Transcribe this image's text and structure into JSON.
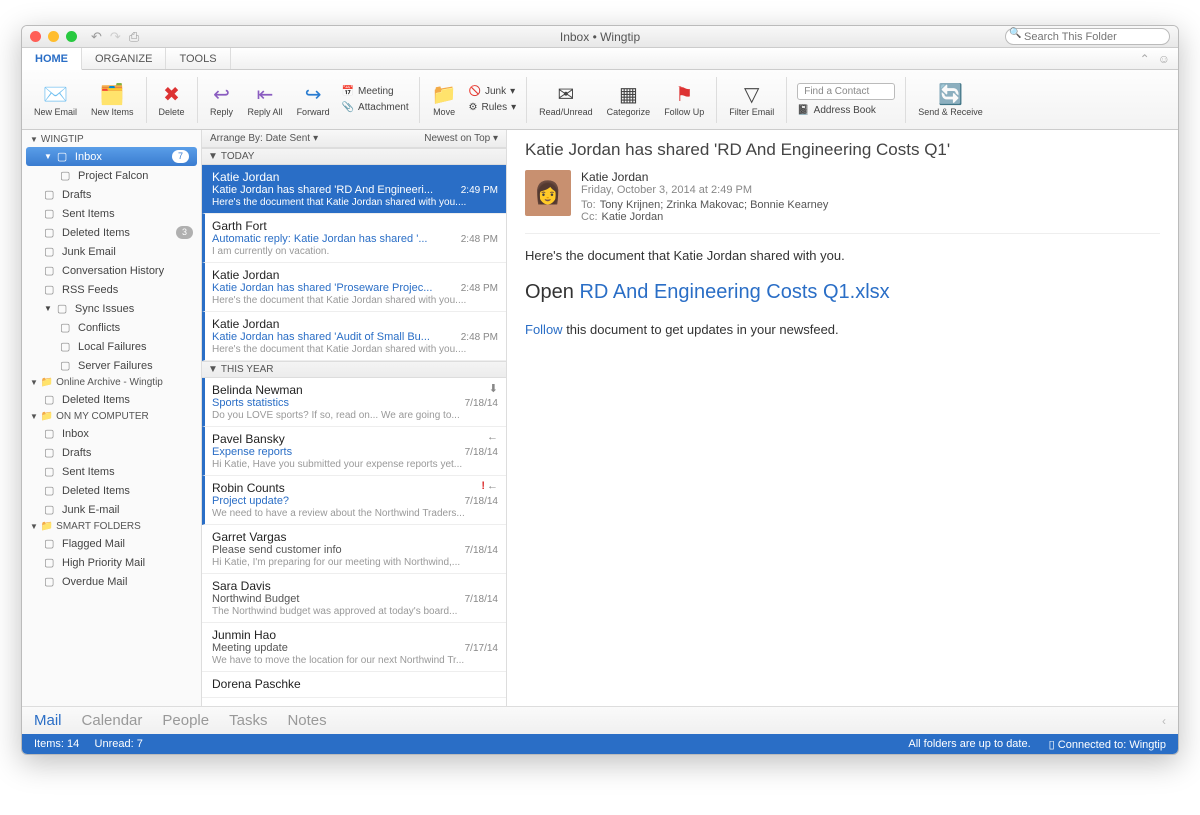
{
  "titlebar": {
    "title": "Inbox • Wingtip",
    "search_placeholder": "Search This Folder"
  },
  "tabs": {
    "home": "HOME",
    "organize": "ORGANIZE",
    "tools": "TOOLS"
  },
  "ribbon": {
    "new_email": "New\nEmail",
    "new_items": "New\nItems",
    "delete": "Delete",
    "reply": "Reply",
    "reply_all": "Reply\nAll",
    "forward": "Forward",
    "meeting": "Meeting",
    "attachment": "Attachment",
    "move": "Move",
    "junk": "Junk",
    "rules": "Rules",
    "read_unread": "Read/Unread",
    "categorize": "Categorize",
    "follow_up": "Follow\nUp",
    "filter_email": "Filter\nEmail",
    "find_contact": "Find a Contact",
    "address_book": "Address Book",
    "send_receive": "Send &\nReceive"
  },
  "sidebar": {
    "accounts": [
      {
        "label": "WINGTIP",
        "items": [
          {
            "label": "Inbox",
            "badge": "7",
            "selected": true
          },
          {
            "label": "Project Falcon",
            "level": 2
          },
          {
            "label": "Drafts"
          },
          {
            "label": "Sent Items"
          },
          {
            "label": "Deleted Items",
            "badge": "3"
          },
          {
            "label": "Junk Email"
          },
          {
            "label": "Conversation History"
          },
          {
            "label": "RSS Feeds"
          },
          {
            "label": "Sync Issues",
            "collapsible": true
          },
          {
            "label": "Conflicts",
            "level": 2
          },
          {
            "label": "Local Failures",
            "level": 2
          },
          {
            "label": "Server Failures",
            "level": 2
          }
        ]
      },
      {
        "label": "Online Archive - Wingtip",
        "items": [
          {
            "label": "Deleted Items"
          }
        ]
      },
      {
        "label": "ON MY COMPUTER",
        "items": [
          {
            "label": "Inbox"
          },
          {
            "label": "Drafts"
          },
          {
            "label": "Sent Items"
          },
          {
            "label": "Deleted Items"
          },
          {
            "label": "Junk E-mail"
          }
        ]
      },
      {
        "label": "SMART FOLDERS",
        "items": [
          {
            "label": "Flagged Mail"
          },
          {
            "label": "High Priority Mail"
          },
          {
            "label": "Overdue Mail"
          }
        ]
      }
    ]
  },
  "arrange": {
    "by": "Arrange By: Date Sent",
    "sort": "Newest on Top"
  },
  "groups": [
    {
      "label": "TODAY",
      "messages": [
        {
          "from": "Katie Jordan",
          "subject": "Katie Jordan has shared 'RD And Engineeri...",
          "time": "2:49 PM",
          "preview": "Here's the document that Katie Jordan shared with you....",
          "unread": true,
          "selected": true
        },
        {
          "from": "Garth Fort",
          "subject": "Automatic reply: Katie Jordan has shared '...",
          "time": "2:48 PM",
          "preview": "I am currently on vacation.",
          "unread": true
        },
        {
          "from": "Katie Jordan",
          "subject": "Katie Jordan has shared 'Proseware Projec...",
          "time": "2:48 PM",
          "preview": "Here's the document that Katie Jordan shared with you....",
          "unread": true
        },
        {
          "from": "Katie Jordan",
          "subject": "Katie Jordan has shared 'Audit of Small Bu...",
          "time": "2:48 PM",
          "preview": "Here's the document that Katie Jordan shared with you....",
          "unread": true
        }
      ]
    },
    {
      "label": "THIS YEAR",
      "messages": [
        {
          "from": "Belinda Newman",
          "subject": "Sports statistics",
          "time": "7/18/14",
          "preview": "Do you LOVE sports? If so, read on... We are going to...",
          "unread": true,
          "flag": "down"
        },
        {
          "from": "Pavel Bansky",
          "subject": "Expense reports",
          "time": "7/18/14",
          "preview": "Hi Katie, Have you submitted your expense reports yet...",
          "unread": true,
          "flag": "reply"
        },
        {
          "from": "Robin Counts",
          "subject": "Project update?",
          "time": "7/18/14",
          "preview": "We need to have a review about the Northwind Traders...",
          "unread": true,
          "flag": "important-reply"
        },
        {
          "from": "Garret Vargas",
          "subject": "Please send customer info",
          "time": "7/18/14",
          "preview": "Hi Katie, I'm preparing for our meeting with Northwind,..."
        },
        {
          "from": "Sara Davis",
          "subject": "Northwind Budget",
          "time": "7/18/14",
          "preview": "The Northwind budget was approved at today's board..."
        },
        {
          "from": "Junmin Hao",
          "subject": "Meeting update",
          "time": "7/17/14",
          "preview": "We have to move the location for our next Northwind Tr..."
        },
        {
          "from": "Dorena Paschke",
          "subject": "",
          "time": "",
          "preview": ""
        }
      ]
    }
  ],
  "reading": {
    "title": "Katie Jordan has shared 'RD And Engineering Costs Q1'",
    "sender": "Katie Jordan",
    "date": "Friday, October 3, 2014 at 2:49 PM",
    "to_label": "To:",
    "to": "Tony Krijnen;   Zrinka Makovac;   Bonnie Kearney",
    "cc_label": "Cc:",
    "cc": "Katie Jordan",
    "body_intro": "Here's the document that Katie Jordan shared with you.",
    "open_prefix": "Open ",
    "open_link": "RD And Engineering Costs Q1.xlsx",
    "follow_link": "Follow",
    "follow_rest": " this document to get updates in your newsfeed."
  },
  "switcher": {
    "mail": "Mail",
    "calendar": "Calendar",
    "people": "People",
    "tasks": "Tasks",
    "notes": "Notes"
  },
  "status": {
    "left": "Items: 14     Unread: 7",
    "right1": "All folders are up to date.",
    "right2": "Connected to: Wingtip"
  }
}
